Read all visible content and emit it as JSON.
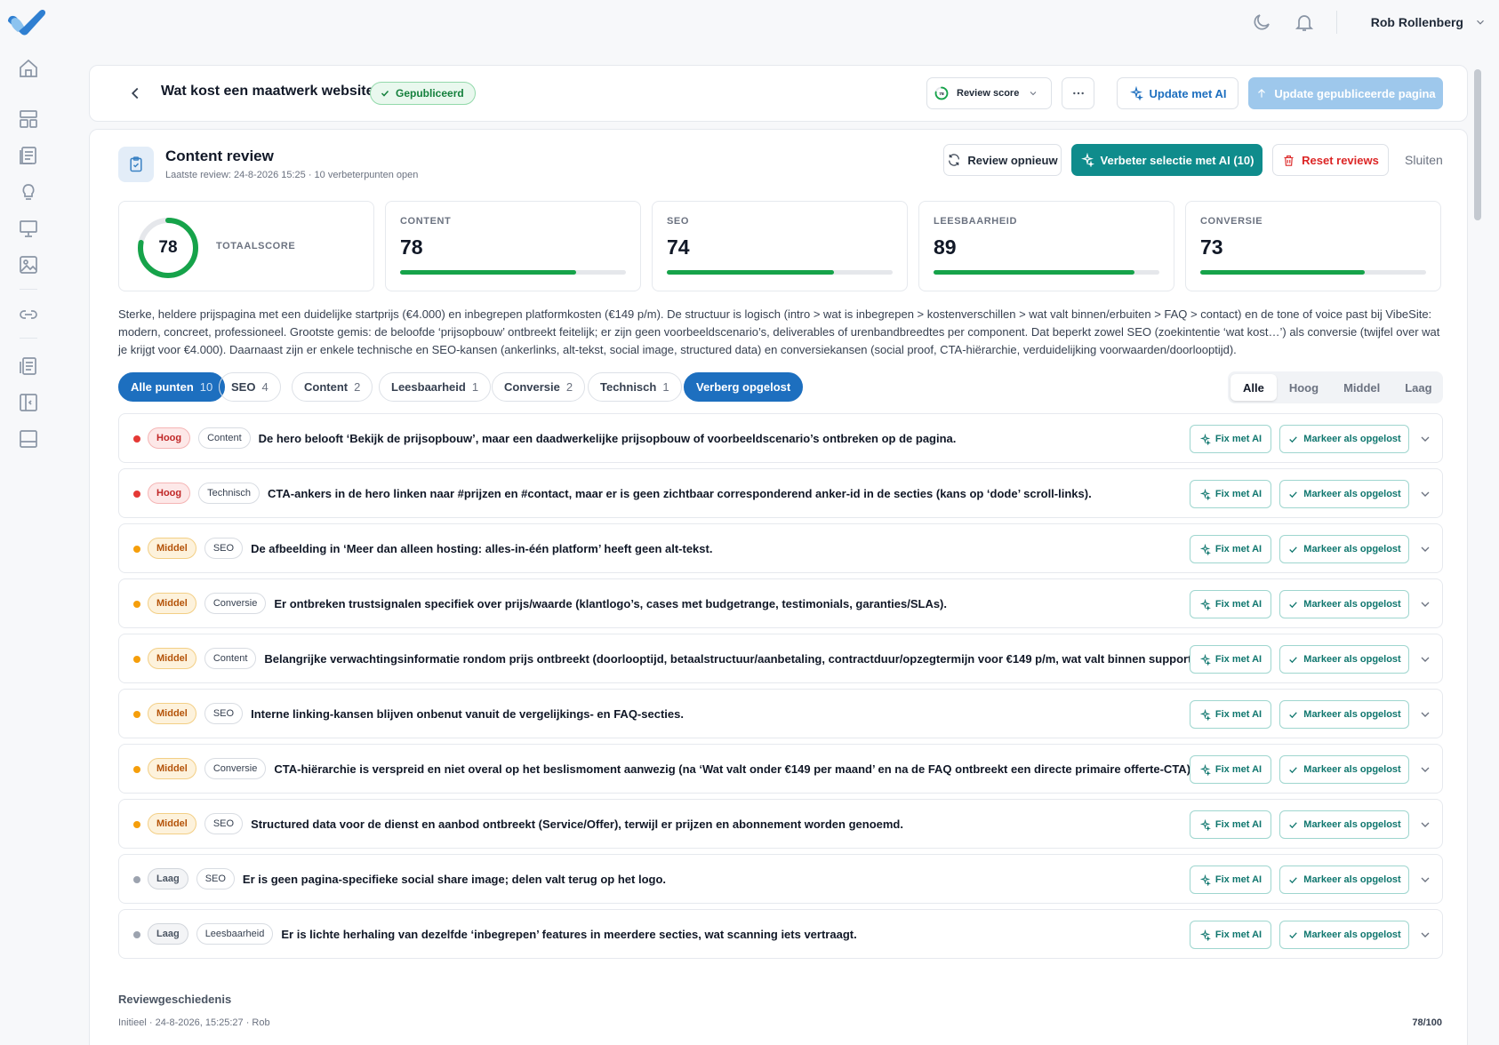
{
  "user": {
    "name": "Rob Rollenberg"
  },
  "header": {
    "title": "Wat kost een maatwerk website?",
    "status": "Gepubliceerd",
    "review_score_value": "78",
    "review_score_label": "Review score",
    "update_ai_label": "Update met AI",
    "update_published_label": "Update gepubliceerde pagina"
  },
  "review": {
    "title": "Content review",
    "subtitle": "Laatste review: 24-8-2026 15:25 · 10 verbeterpunten open",
    "actions": {
      "rerun": "Review opnieuw",
      "improve": "Verbeter selectie met AI (10)",
      "reset": "Reset reviews",
      "close": "Sluiten"
    },
    "total": {
      "value": "78",
      "label": "TOTAALSCORE",
      "fraction": 0.78
    },
    "scores": [
      {
        "label": "CONTENT",
        "value": "78",
        "fraction": 0.78
      },
      {
        "label": "SEO",
        "value": "74",
        "fraction": 0.74
      },
      {
        "label": "LEESBAARHEID",
        "value": "89",
        "fraction": 0.89
      },
      {
        "label": "CONVERSIE",
        "value": "73",
        "fraction": 0.73
      }
    ],
    "summary": "Sterke, heldere prijspagina met een duidelijke startprijs (€4.000) en inbegrepen platformkosten (€149 p/m). De structuur is logisch (intro > wat is inbegrepen > kostenverschillen > wat valt binnen/erbuiten > FAQ > contact) en de tone of voice past bij VibeSite: modern, concreet, professioneel. Grootste gemis: de beloofde ‘prijsopbouw’ ontbreekt feitelijk; er zijn geen voorbeeldscenario’s, deliverables of urenbandbreedtes per component. Dat beperkt zowel SEO (zoekintentie ‘wat kost…’) als conversie (twijfel over wat je krijgt voor €4.000). Daarnaast zijn er enkele technische en SEO-kansen (ankerlinks, alt-tekst, social image, structured data) en conversiekansen (social proof, CTA-hiërarchie, verduidelijking voorwaarden/doorlooptijd).",
    "filters": [
      {
        "label": "Alle punten",
        "count": "10",
        "active": true
      },
      {
        "label": "SEO",
        "count": "4",
        "active": false
      },
      {
        "label": "Content",
        "count": "2",
        "active": false
      },
      {
        "label": "Leesbaarheid",
        "count": "1",
        "active": false
      },
      {
        "label": "Conversie",
        "count": "2",
        "active": false
      },
      {
        "label": "Technisch",
        "count": "1",
        "active": false
      },
      {
        "label": "Verberg opgelost",
        "count": "",
        "active": true
      }
    ],
    "severity_tabs": [
      "Alle",
      "Hoog",
      "Middel",
      "Laag"
    ],
    "fix_label": "Fix met AI",
    "mark_label": "Markeer als opgelost",
    "issues": [
      {
        "severity": "Hoog",
        "category": "Content",
        "text": "De hero belooft ‘Bekijk de prijsopbouw’, maar een daadwerkelijke prijsopbouw of voorbeeldscenario’s ontbreken op de pagina."
      },
      {
        "severity": "Hoog",
        "category": "Technisch",
        "text": "CTA-ankers in de hero linken naar #prijzen en #contact, maar er is geen zichtbaar corresponderend anker-id in de secties (kans op ‘dode’ scroll-links)."
      },
      {
        "severity": "Middel",
        "category": "SEO",
        "text": "De afbeelding in ‘Meer dan alleen hosting: alles-in-één platform’ heeft geen alt-tekst."
      },
      {
        "severity": "Middel",
        "category": "Conversie",
        "text": "Er ontbreken trustsignalen specifiek over prijs/waarde (klantlogo’s, cases met budgetrange, testimonials, garanties/SLAs)."
      },
      {
        "severity": "Middel",
        "category": "Content",
        "text": "Belangrijke verwachtingsinformatie rondom prijs ontbreekt (doorlooptijd, betaalstructuur/aanbetaling, contractduur/opzegtermijn voor €149 p/m, wat valt binnen support)."
      },
      {
        "severity": "Middel",
        "category": "SEO",
        "text": "Interne linking-kansen blijven onbenut vanuit de vergelijkings- en FAQ-secties."
      },
      {
        "severity": "Middel",
        "category": "Conversie",
        "text": "CTA-hiërarchie is verspreid en niet overal op het beslismoment aanwezig (na ‘Wat valt onder €149 per maand’ en na de FAQ ontbreekt een directe primaire offerte-CTA)."
      },
      {
        "severity": "Middel",
        "category": "SEO",
        "text": "Structured data voor de dienst en aanbod ontbreekt (Service/Offer), terwijl er prijzen en abonnement worden genoemd."
      },
      {
        "severity": "Laag",
        "category": "SEO",
        "text": "Er is geen pagina-specifieke social share image; delen valt terug op het logo."
      },
      {
        "severity": "Laag",
        "category": "Leesbaarheid",
        "text": "Er is lichte herhaling van dezelfde ‘inbegrepen’ features in meerdere secties, wat scanning iets vertraagt."
      }
    ],
    "history": {
      "title": "Reviewgeschiedenis",
      "entry": "Initieel · 24-8-2026, 15:25:27 · Rob",
      "score": "78/100"
    }
  },
  "colors": {
    "primary": "#1d6fbf",
    "teal": "#0f8c8c",
    "success": "#16a34a",
    "danger": "#dc2626",
    "high": "#e53935",
    "medium": "#f59e0b",
    "low": "#9ca3af"
  }
}
